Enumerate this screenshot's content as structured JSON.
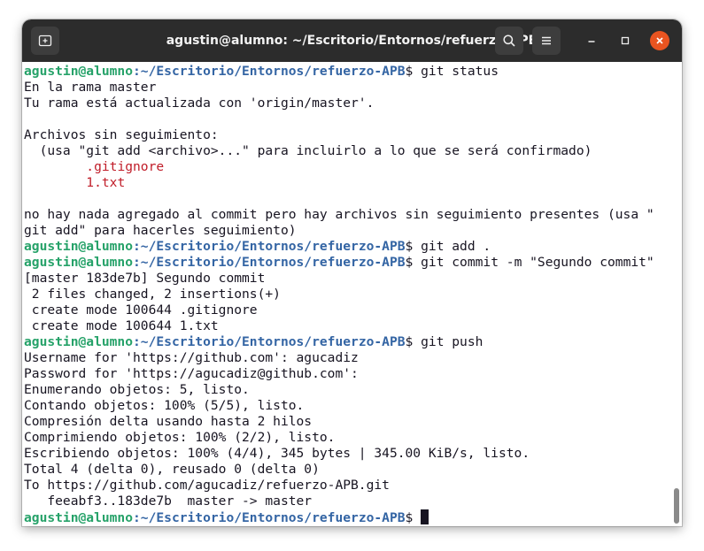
{
  "window": {
    "title": "agustin@alumno: ~/Escritorio/Entornos/refuerzo-APB"
  },
  "prompt": {
    "user_host": "agustin@alumno",
    "path": ":~/Escritorio/Entornos/refuerzo-APB",
    "symbol": "$"
  },
  "colors": {
    "prompt_user": "#26a269",
    "prompt_path": "#3465a4",
    "untracked_files": "#c01c28",
    "close_button": "#e95420"
  },
  "terminal": {
    "lines": [
      {
        "type": "prompt",
        "command": " git status"
      },
      {
        "type": "out",
        "text": "En la rama master"
      },
      {
        "type": "out",
        "text": "Tu rama está actualizada con 'origin/master'."
      },
      {
        "type": "out",
        "text": ""
      },
      {
        "type": "out",
        "text": "Archivos sin seguimiento:"
      },
      {
        "type": "out",
        "text": "  (usa \"git add <archivo>...\" para incluirlo a lo que se será confirmado)"
      },
      {
        "type": "red",
        "text": "\t.gitignore"
      },
      {
        "type": "red",
        "text": "\t1.txt"
      },
      {
        "type": "out",
        "text": ""
      },
      {
        "type": "out",
        "text": "no hay nada agregado al commit pero hay archivos sin seguimiento presentes (usa \""
      },
      {
        "type": "out",
        "text": "git add\" para hacerles seguimiento)"
      },
      {
        "type": "prompt",
        "command": " git add ."
      },
      {
        "type": "prompt",
        "command": " git commit -m \"Segundo commit\""
      },
      {
        "type": "out",
        "text": "[master 183de7b] Segundo commit"
      },
      {
        "type": "out",
        "text": " 2 files changed, 2 insertions(+)"
      },
      {
        "type": "out",
        "text": " create mode 100644 .gitignore"
      },
      {
        "type": "out",
        "text": " create mode 100644 1.txt"
      },
      {
        "type": "prompt",
        "command": " git push"
      },
      {
        "type": "out",
        "text": "Username for 'https://github.com': agucadiz"
      },
      {
        "type": "out",
        "text": "Password for 'https://agucadiz@github.com':"
      },
      {
        "type": "out",
        "text": "Enumerando objetos: 5, listo."
      },
      {
        "type": "out",
        "text": "Contando objetos: 100% (5/5), listo."
      },
      {
        "type": "out",
        "text": "Compresión delta usando hasta 2 hilos"
      },
      {
        "type": "out",
        "text": "Comprimiendo objetos: 100% (2/2), listo."
      },
      {
        "type": "out",
        "text": "Escribiendo objetos: 100% (4/4), 345 bytes | 345.00 KiB/s, listo."
      },
      {
        "type": "out",
        "text": "Total 4 (delta 0), reusado 0 (delta 0)"
      },
      {
        "type": "out",
        "text": "To https://github.com/agucadiz/refuerzo-APB.git"
      },
      {
        "type": "out",
        "text": "   feeabf3..183de7b  master -> master"
      },
      {
        "type": "prompt",
        "command": " ",
        "cursor": true
      }
    ]
  }
}
